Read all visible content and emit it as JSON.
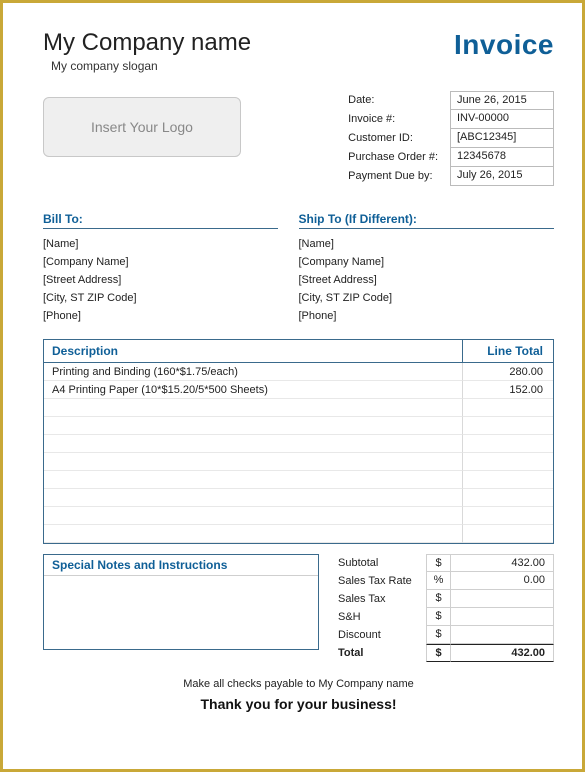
{
  "header": {
    "company_name": "My Company name",
    "company_slogan": "My company slogan",
    "invoice_title": "Invoice",
    "logo_placeholder": "Insert Your Logo"
  },
  "meta": {
    "labels": {
      "date": "Date:",
      "invoice_no": "Invoice #:",
      "customer_id": "Customer ID:",
      "po": "Purchase Order #:",
      "due": "Payment Due by:"
    },
    "values": {
      "date": "June 26, 2015",
      "invoice_no": "INV-00000",
      "customer_id": "[ABC12345]",
      "po": "12345678",
      "due": "July 26, 2015"
    }
  },
  "bill_to": {
    "heading": "Bill To:",
    "name": "[Name]",
    "company": "[Company Name]",
    "street": "[Street Address]",
    "citystzip": "[City, ST ZIP Code]",
    "phone": "[Phone]"
  },
  "ship_to": {
    "heading": "Ship To (If Different):",
    "name": "[Name]",
    "company": "[Company Name]",
    "street": "[Street Address]",
    "citystzip": "[City, ST ZIP Code]",
    "phone": "[Phone]"
  },
  "items": {
    "header_desc": "Description",
    "header_total": "Line Total",
    "rows": [
      {
        "desc": "Printing and Binding (160*$1.75/each)",
        "total": "280.00"
      },
      {
        "desc": "A4 Printing Paper (10*$15.20/5*500 Sheets)",
        "total": "152.00"
      },
      {
        "desc": "",
        "total": ""
      },
      {
        "desc": "",
        "total": ""
      },
      {
        "desc": "",
        "total": ""
      },
      {
        "desc": "",
        "total": ""
      },
      {
        "desc": "",
        "total": ""
      },
      {
        "desc": "",
        "total": ""
      },
      {
        "desc": "",
        "total": ""
      },
      {
        "desc": "",
        "total": ""
      }
    ]
  },
  "notes": {
    "heading": "Special Notes and Instructions"
  },
  "totals": {
    "subtotal_label": "Subtotal",
    "subtotal_unit": "$",
    "subtotal_val": "432.00",
    "taxrate_label": "Sales Tax Rate",
    "taxrate_unit": "%",
    "taxrate_val": "0.00",
    "salestax_label": "Sales Tax",
    "salestax_unit": "$",
    "salestax_val": "",
    "sh_label": "S&H",
    "sh_unit": "$",
    "sh_val": "",
    "discount_label": "Discount",
    "discount_unit": "$",
    "discount_val": "",
    "total_label": "Total",
    "total_unit": "$",
    "total_val": "432.00"
  },
  "footer": {
    "payable": "Make all checks payable to My Company name",
    "thankyou": "Thank you for your business!"
  }
}
